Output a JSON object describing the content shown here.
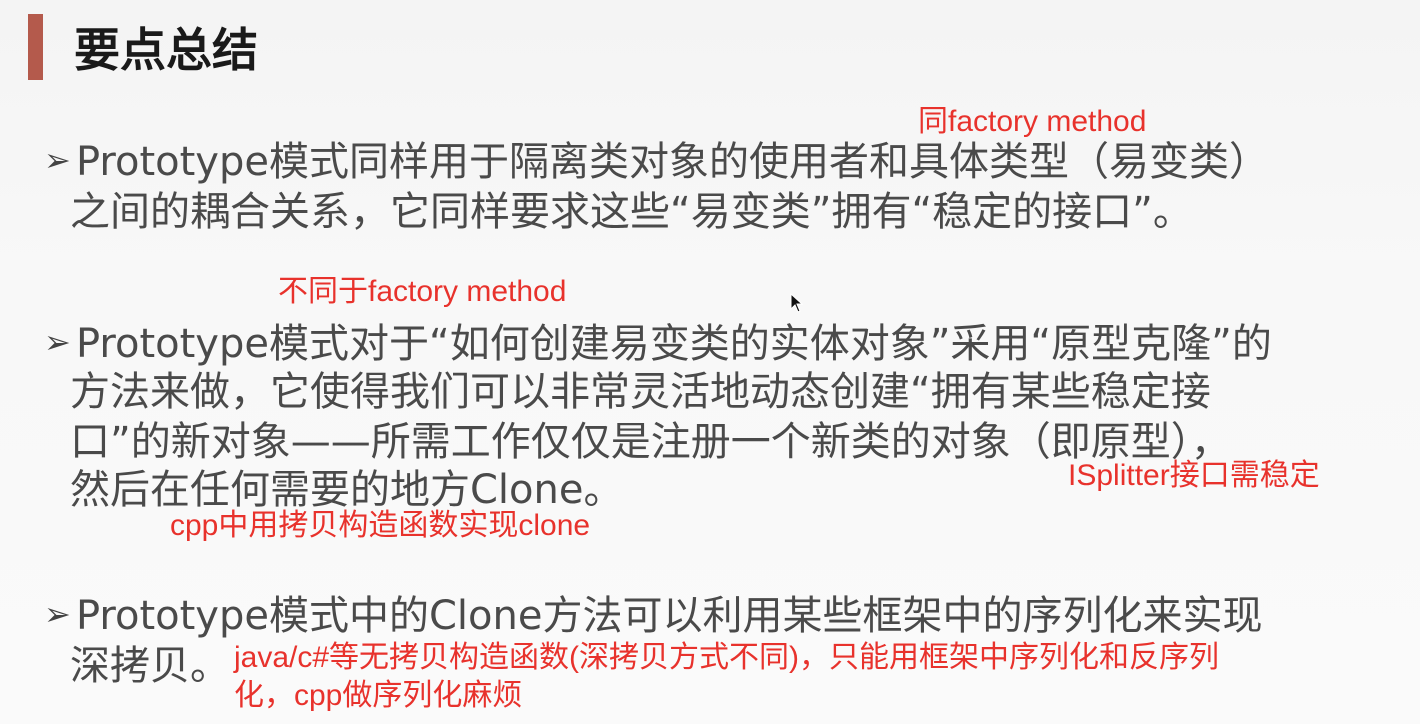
{
  "title": "要点总结",
  "bullets": [
    {
      "lines": [
        "Prototype模式同样用于隔离类对象的使用者和具体类型（易变类）",
        "之间的耦合关系，它同样要求这些“易变类”拥有“稳定的接口”。"
      ]
    },
    {
      "lines": [
        "Prototype模式对于“如何创建易变类的实体对象”采用“原型克隆”的",
        "方法来做，它使得我们可以非常灵活地动态创建“拥有某些稳定接",
        "口”的新对象——所需工作仅仅是注册一个新类的对象（即原型），",
        "然后在任何需要的地方Clone。"
      ]
    },
    {
      "lines": [
        "Prototype模式中的Clone方法可以利用某些框架中的序列化来实现",
        "深拷贝。"
      ]
    }
  ],
  "notes": {
    "same_factory": "同factory method",
    "diff_factory": "不同于factory method",
    "isplitter": "ISplitter接口需稳定",
    "cpp_clone": "cpp中用拷贝构造函数实现clone",
    "java_line1": "java/c#等无拷贝构造函数(深拷贝方式不同)，只能用框架中序列化和反序列",
    "java_line2": "化，cpp做序列化麻烦"
  },
  "colors": {
    "accent_bar": "#b45a4c",
    "note_red": "#e8322c",
    "body_text": "#4a4a4a"
  }
}
